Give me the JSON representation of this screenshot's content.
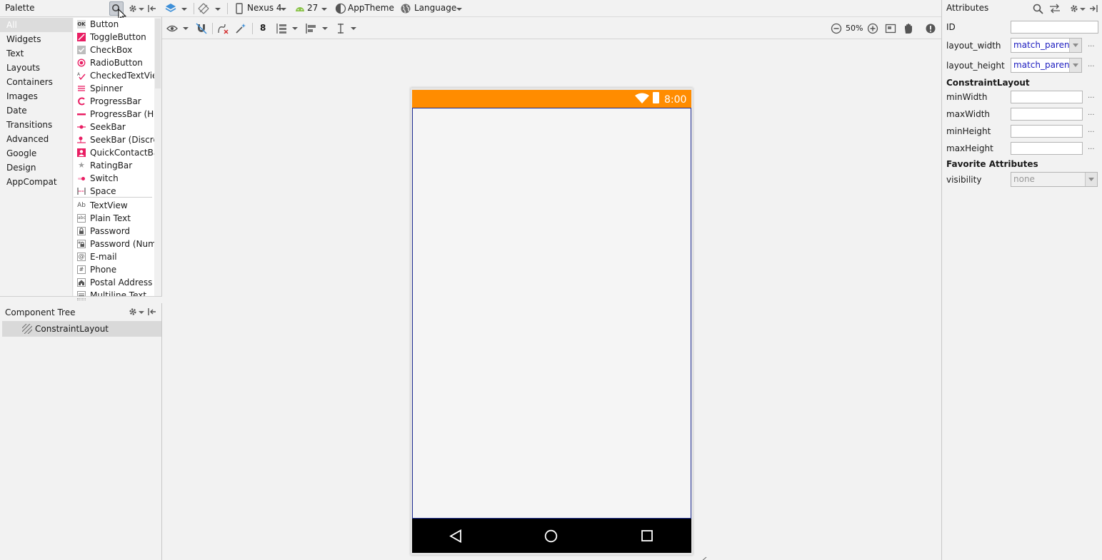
{
  "palette": {
    "title": "Palette",
    "categories": [
      "All",
      "Widgets",
      "Text",
      "Layouts",
      "Containers",
      "Images",
      "Date",
      "Transitions",
      "Advanced",
      "Google",
      "Design",
      "AppCompat"
    ],
    "selected_category": "All",
    "widgets": [
      {
        "label": "Button",
        "icon": "OK"
      },
      {
        "label": "ToggleButton",
        "icon": "toggle"
      },
      {
        "label": "CheckBox",
        "icon": "check"
      },
      {
        "label": "RadioButton",
        "icon": "radio"
      },
      {
        "label": "CheckedTextView",
        "icon": "checked-text"
      },
      {
        "label": "Spinner",
        "icon": "spinner"
      },
      {
        "label": "ProgressBar",
        "icon": "progress"
      },
      {
        "label": "ProgressBar (Horizontal)",
        "icon": "progress-h"
      },
      {
        "label": "SeekBar",
        "icon": "seek"
      },
      {
        "label": "SeekBar (Discrete)",
        "icon": "seek-d"
      },
      {
        "label": "QuickContactBadge",
        "icon": "contact"
      },
      {
        "label": "RatingBar",
        "icon": "star"
      },
      {
        "label": "Switch",
        "icon": "switch"
      },
      {
        "label": "Space",
        "icon": "space"
      }
    ],
    "text_widgets": [
      {
        "label": "TextView",
        "icon": "Ab"
      },
      {
        "label": "Plain Text",
        "icon": "abc"
      },
      {
        "label": "Password",
        "icon": "lock"
      },
      {
        "label": "Password (Numeric)",
        "icon": "lock-num"
      },
      {
        "label": "E-mail",
        "icon": "@"
      },
      {
        "label": "Phone",
        "icon": "#"
      },
      {
        "label": "Postal Address",
        "icon": "home"
      },
      {
        "label": "Multiline Text",
        "icon": "lines"
      }
    ]
  },
  "component_tree": {
    "title": "Component Tree",
    "root": "ConstraintLayout"
  },
  "toolbar": {
    "device": "Nexus 4",
    "api_level": "27",
    "theme": "AppTheme",
    "language": "Language",
    "margin": "8",
    "zoom": "50%"
  },
  "device_preview": {
    "clock": "8:00",
    "status_color": "#ff8c00"
  },
  "attributes": {
    "title": "Attributes",
    "id_label": "ID",
    "id_value": "",
    "layout_width_label": "layout_width",
    "layout_width_value": "match_parent",
    "layout_height_label": "layout_height",
    "layout_height_value": "match_parent",
    "section_constraint": "ConstraintLayout",
    "min_width_label": "minWidth",
    "max_width_label": "maxWidth",
    "min_height_label": "minHeight",
    "max_height_label": "maxHeight",
    "section_favorites": "Favorite Attributes",
    "visibility_label": "visibility",
    "visibility_value": "none",
    "more": "..."
  }
}
